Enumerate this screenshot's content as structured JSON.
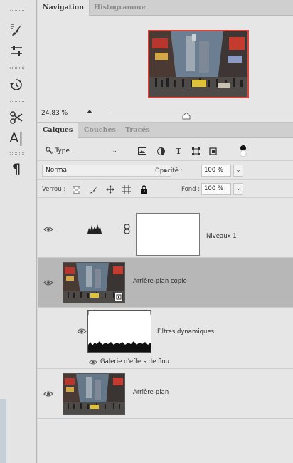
{
  "toolbar": {
    "tools": [
      {
        "name": "brush-settings-tool-icon"
      },
      {
        "name": "adjustment-sliders-tool-icon"
      },
      {
        "name": "history-brush-tool-icon"
      },
      {
        "name": "clone-tool-icon"
      },
      {
        "name": "character-tool-icon",
        "glyph": "A|"
      },
      {
        "name": "paragraph-tool-icon",
        "glyph": "¶"
      }
    ]
  },
  "navigator": {
    "tabs": [
      {
        "label": "Navigation",
        "active": true
      },
      {
        "label": "Histogramme",
        "active": false
      }
    ],
    "zoom": "24,83 %",
    "zoom_slider_fraction": 0.42,
    "frame_color": "#d8433a"
  },
  "layers_panel": {
    "tabs": [
      {
        "label": "Calques",
        "active": true
      },
      {
        "label": "Couches",
        "active": false
      },
      {
        "label": "Tracés",
        "active": false
      }
    ],
    "filter": {
      "kind_label": "Type",
      "icons": [
        "pixel-filter-icon",
        "adjustment-filter-icon",
        "type-filter-icon",
        "shape-filter-icon",
        "smart-object-filter-icon"
      ],
      "type_glyph": "T"
    },
    "blend_mode": "Normal",
    "opacity_label": "Opacité :",
    "opacity_value": "100 %",
    "lock_label": "Verrou :",
    "fill_label": "Fond :",
    "fill_value": "100 %",
    "layers": [
      {
        "name": "Niveaux 1",
        "kind": "adjustment"
      },
      {
        "name": "Arrière-plan copie",
        "kind": "smart-object",
        "selected": true
      },
      {
        "name": "Filtres dynamiques",
        "kind": "smart-filter-mask"
      },
      {
        "name": "Galerie d'effets de flou",
        "kind": "smart-filter"
      },
      {
        "name": "Arrière-plan",
        "kind": "pixel"
      }
    ]
  }
}
